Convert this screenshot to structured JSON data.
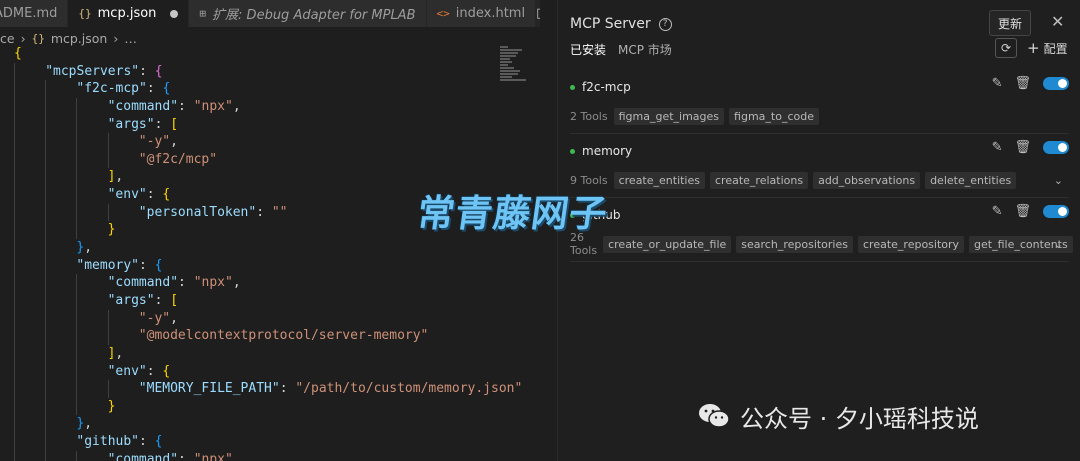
{
  "editor": {
    "tabs": [
      {
        "label": "ADME.md",
        "icon": "markdown-icon",
        "active": false
      },
      {
        "label": "mcp.json",
        "icon_text": "{}",
        "active": true,
        "modified": true
      },
      {
        "label": "扩展: Debug Adapter for MPLAB",
        "icon": "extension-icon",
        "active": false
      },
      {
        "label": "index.html",
        "icon_text": "<>",
        "active": false
      }
    ],
    "breadcrumb": {
      "part1": "ce",
      "sep": "›",
      "file": "mcp.json",
      "more": "…"
    },
    "code": [
      "{",
      "\"mcpServers\": {",
      "\"f2c-mcp\": {",
      "\"command\": \"npx\",",
      "\"args\": [",
      "\"-y\",",
      "\"@f2c/mcp\"",
      "],",
      "\"env\": {",
      "\"personalToken\": \"\"",
      "}",
      "},",
      "\"memory\": {",
      "\"command\": \"npx\",",
      "\"args\": [",
      "\"-y\",",
      "\"@modelcontextprotocol/server-memory\"",
      "],",
      "\"env\": {",
      "\"MEMORY_FILE_PATH\": \"/path/to/custom/memory.json\"",
      "}",
      "},",
      "\"github\": {",
      "\"command\": \"npx\""
    ]
  },
  "panel": {
    "title": "MCP Server",
    "update_tooltip": "更新",
    "tabs": [
      "已安装",
      "MCP 市场"
    ],
    "add_config_label": "配置",
    "servers": [
      {
        "name": "f2c-mcp",
        "tools_count": "2 Tools",
        "tools": [
          "figma_get_images",
          "figma_to_code"
        ],
        "expandable": false
      },
      {
        "name": "memory",
        "tools_count": "9 Tools",
        "tools": [
          "create_entities",
          "create_relations",
          "add_observations",
          "delete_entities"
        ],
        "expandable": true
      },
      {
        "name": "github",
        "tools_count": "26 Tools",
        "tools": [
          "create_or_update_file",
          "search_repositories",
          "create_repository",
          "get_file_contents"
        ],
        "expandable": true
      }
    ]
  },
  "overlay": {
    "watermark": "常青藤网子",
    "credit": "公众号 · 夕小瑶科技说"
  },
  "colors": {
    "accent": "#1f8ad2",
    "status_ok": "#3fb950",
    "watermark": "#6ec4f4"
  }
}
